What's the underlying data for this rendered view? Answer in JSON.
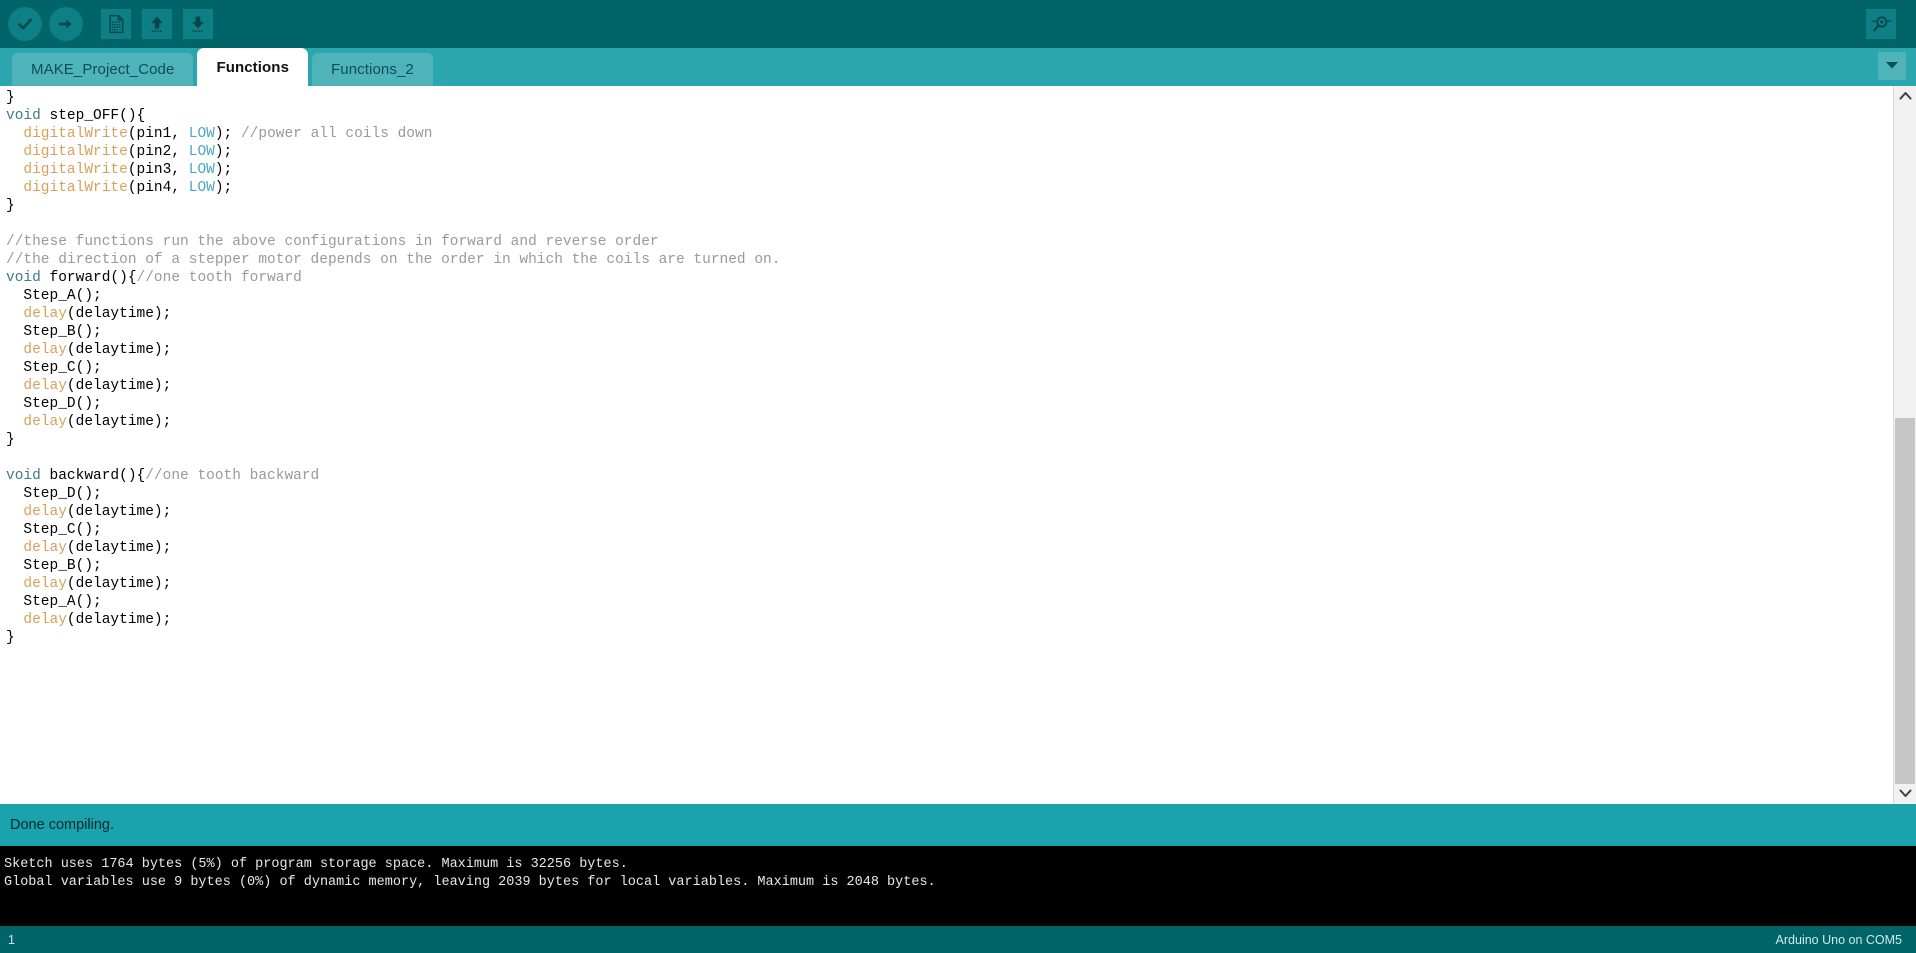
{
  "toolbar": {
    "buttons": [
      {
        "name": "verify-compile-button",
        "icon": "checkmark-icon",
        "shape": "round",
        "title": "Verify"
      },
      {
        "name": "upload-button",
        "icon": "arrow-right-icon",
        "shape": "round",
        "title": "Upload"
      },
      {
        "name": "new-sketch-button",
        "icon": "new-document-icon",
        "shape": "square",
        "title": "New"
      },
      {
        "name": "open-sketch-button",
        "icon": "arrow-up-icon",
        "shape": "square",
        "title": "Open"
      },
      {
        "name": "save-sketch-button",
        "icon": "arrow-down-icon",
        "shape": "square",
        "title": "Save"
      }
    ],
    "serial_monitor": {
      "name": "serial-monitor-button",
      "icon": "magnifier-icon",
      "title": "Serial Monitor"
    }
  },
  "tabs": {
    "items": [
      {
        "label": "MAKE_Project_Code",
        "active": false
      },
      {
        "label": "Functions",
        "active": true
      },
      {
        "label": "Functions_2",
        "active": false
      }
    ],
    "menu_icon": "chevron-down-icon"
  },
  "editor": {
    "lines": [
      [
        {
          "t": "}",
          "c": "plain"
        }
      ],
      [
        {
          "t": "void",
          "c": "kw"
        },
        {
          "t": " step_OFF(){",
          "c": "plain"
        }
      ],
      [
        {
          "t": "  ",
          "c": "plain"
        },
        {
          "t": "digitalWrite",
          "c": "fn"
        },
        {
          "t": "(pin1, ",
          "c": "plain"
        },
        {
          "t": "LOW",
          "c": "const"
        },
        {
          "t": "); ",
          "c": "plain"
        },
        {
          "t": "//power all coils down",
          "c": "comment"
        }
      ],
      [
        {
          "t": "  ",
          "c": "plain"
        },
        {
          "t": "digitalWrite",
          "c": "fn"
        },
        {
          "t": "(pin2, ",
          "c": "plain"
        },
        {
          "t": "LOW",
          "c": "const"
        },
        {
          "t": ");",
          "c": "plain"
        }
      ],
      [
        {
          "t": "  ",
          "c": "plain"
        },
        {
          "t": "digitalWrite",
          "c": "fn"
        },
        {
          "t": "(pin3, ",
          "c": "plain"
        },
        {
          "t": "LOW",
          "c": "const"
        },
        {
          "t": ");",
          "c": "plain"
        }
      ],
      [
        {
          "t": "  ",
          "c": "plain"
        },
        {
          "t": "digitalWrite",
          "c": "fn"
        },
        {
          "t": "(pin4, ",
          "c": "plain"
        },
        {
          "t": "LOW",
          "c": "const"
        },
        {
          "t": ");",
          "c": "plain"
        }
      ],
      [
        {
          "t": "}",
          "c": "plain"
        }
      ],
      [
        {
          "t": "",
          "c": "plain"
        }
      ],
      [
        {
          "t": "//these functions run the above configurations in forward and reverse order",
          "c": "comment"
        }
      ],
      [
        {
          "t": "//the direction of a stepper motor depends on the order in which the coils are turned on.",
          "c": "comment"
        }
      ],
      [
        {
          "t": "void",
          "c": "kw"
        },
        {
          "t": " forward(){",
          "c": "plain"
        },
        {
          "t": "//one tooth forward",
          "c": "comment"
        }
      ],
      [
        {
          "t": "  Step_A();",
          "c": "plain"
        }
      ],
      [
        {
          "t": "  ",
          "c": "plain"
        },
        {
          "t": "delay",
          "c": "fn"
        },
        {
          "t": "(delaytime);",
          "c": "plain"
        }
      ],
      [
        {
          "t": "  Step_B();",
          "c": "plain"
        }
      ],
      [
        {
          "t": "  ",
          "c": "plain"
        },
        {
          "t": "delay",
          "c": "fn"
        },
        {
          "t": "(delaytime);",
          "c": "plain"
        }
      ],
      [
        {
          "t": "  Step_C();",
          "c": "plain"
        }
      ],
      [
        {
          "t": "  ",
          "c": "plain"
        },
        {
          "t": "delay",
          "c": "fn"
        },
        {
          "t": "(delaytime);",
          "c": "plain"
        }
      ],
      [
        {
          "t": "  Step_D();",
          "c": "plain"
        }
      ],
      [
        {
          "t": "  ",
          "c": "plain"
        },
        {
          "t": "delay",
          "c": "fn"
        },
        {
          "t": "(delaytime);",
          "c": "plain"
        }
      ],
      [
        {
          "t": "}",
          "c": "plain"
        }
      ],
      [
        {
          "t": "",
          "c": "plain"
        }
      ],
      [
        {
          "t": "void",
          "c": "kw"
        },
        {
          "t": " backward(){",
          "c": "plain"
        },
        {
          "t": "//one tooth backward",
          "c": "comment"
        }
      ],
      [
        {
          "t": "  Step_D();",
          "c": "plain"
        }
      ],
      [
        {
          "t": "  ",
          "c": "plain"
        },
        {
          "t": "delay",
          "c": "fn"
        },
        {
          "t": "(delaytime);",
          "c": "plain"
        }
      ],
      [
        {
          "t": "  Step_C();",
          "c": "plain"
        }
      ],
      [
        {
          "t": "  ",
          "c": "plain"
        },
        {
          "t": "delay",
          "c": "fn"
        },
        {
          "t": "(delaytime);",
          "c": "plain"
        }
      ],
      [
        {
          "t": "  Step_B();",
          "c": "plain"
        }
      ],
      [
        {
          "t": "  ",
          "c": "plain"
        },
        {
          "t": "delay",
          "c": "fn"
        },
        {
          "t": "(delaytime);",
          "c": "plain"
        }
      ],
      [
        {
          "t": "  Step_A();",
          "c": "plain"
        }
      ],
      [
        {
          "t": "  ",
          "c": "plain"
        },
        {
          "t": "delay",
          "c": "fn"
        },
        {
          "t": "(delaytime);",
          "c": "plain"
        }
      ],
      [
        {
          "t": "}",
          "c": "plain"
        }
      ]
    ],
    "scrollbar": {
      "up_icon": "chevron-up-icon",
      "down_icon": "chevron-down-icon",
      "thumb_top_pct": 46,
      "thumb_height_pct": 54
    }
  },
  "status": {
    "message": "Done compiling."
  },
  "console": {
    "lines": [
      "Sketch uses 1764 bytes (5%) of program storage space. Maximum is 32256 bytes.",
      "Global variables use 9 bytes (0%) of dynamic memory, leaving 2039 bytes for local variables. Maximum is 2048 bytes."
    ]
  },
  "bottombar": {
    "line_number": "1",
    "board_info": "Arduino Uno on COM5"
  },
  "colors": {
    "toolbar_bg": "#006469",
    "tabbar_bg": "#2ba6ae",
    "tab_inactive_bg": "#4fb3ba",
    "tab_active_bg": "#ffffff",
    "status_bg": "#1aa3ac",
    "console_bg": "#000000",
    "keyword": "#3d7a85",
    "function": "#d9a05b",
    "constant": "#4aa8c4",
    "comment": "#9a9a9a"
  }
}
